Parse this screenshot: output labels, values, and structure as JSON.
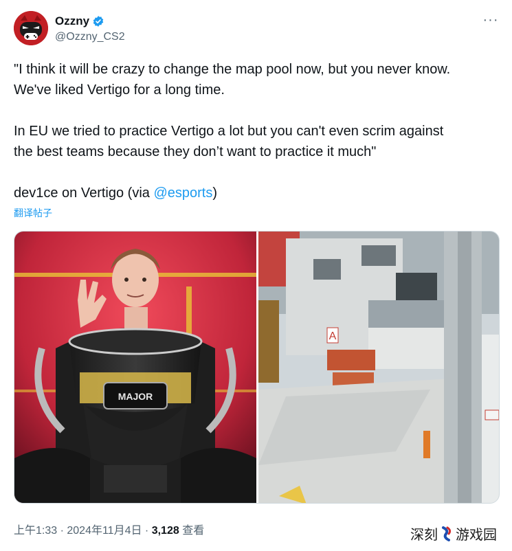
{
  "user": {
    "display_name": "Ozzny",
    "handle": "@Ozzny_CS2",
    "verified_icon": "verified-badge-icon",
    "avatar_icon": "gamepad-face-icon",
    "brand_color": "#c21f24"
  },
  "menu": {
    "more_icon": "ellipsis-icon",
    "more_label": "···"
  },
  "tweet": {
    "line1": "\"I think it will be crazy to change the map pool now, but you never know.",
    "line2": "We've liked Vertigo for a long time.",
    "line3": "In EU we tried to practice Vertigo a lot but you can't even scrim against",
    "line4": "the best teams because they don’t want to practice it much\"",
    "credit_prefix": "dev1ce on Vertigo (via ",
    "credit_mention": "@esports",
    "credit_suffix": ")"
  },
  "translate_label": "翻译帖子",
  "media": {
    "left_caption": "MAJOR",
    "right_sign": "A"
  },
  "meta": {
    "time": "上午1:33",
    "sep1": " · ",
    "date": "2024年11月4日",
    "sep2": " · ",
    "views_count": "3,128",
    "views_label": " 查看"
  },
  "watermark": {
    "text_left": "深刻",
    "text_right": "游戏园"
  },
  "colors": {
    "link": "#1d9bf0",
    "muted": "#536471",
    "text": "#0f1419"
  }
}
